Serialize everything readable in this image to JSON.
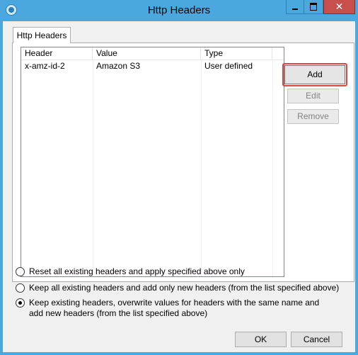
{
  "window": {
    "title": "Http Headers",
    "minimize_label": "",
    "maximize_label": "",
    "close_glyph": "✕"
  },
  "tab": {
    "label": "Http Headers"
  },
  "table": {
    "columns": [
      "Header",
      "Value",
      "Type"
    ],
    "rows": [
      {
        "header": "x-amz-id-2",
        "value": "Amazon S3",
        "type": "User defined"
      }
    ]
  },
  "buttons": {
    "add": "Add",
    "edit": "Edit",
    "remove": "Remove",
    "ok": "OK",
    "cancel": "Cancel"
  },
  "options": [
    {
      "label": "Reset all existing headers and apply specified above only",
      "checked": false
    },
    {
      "label": "Keep all existing headers and add only new headers (from the list specified above)",
      "checked": false
    },
    {
      "label": "Keep existing headers, overwrite values for headers with the same name and add new headers (from the list specified above)",
      "checked": true
    }
  ],
  "colors": {
    "titlebar": "#4aa8df",
    "close_button": "#c7504c",
    "highlight": "#e0463f"
  }
}
